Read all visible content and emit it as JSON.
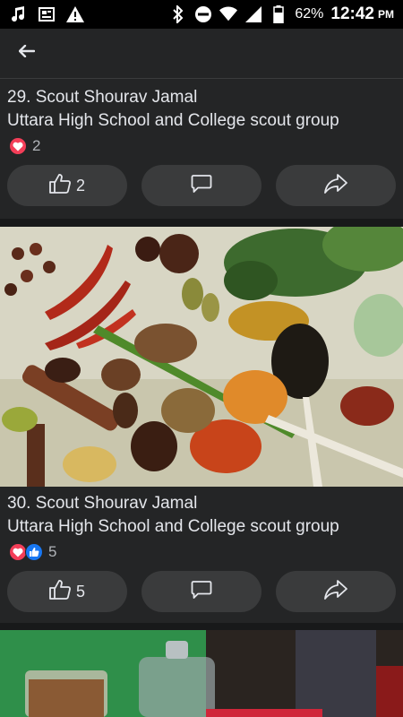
{
  "status_bar": {
    "battery": "62%",
    "time": "12:42",
    "ampm": "PM",
    "icons": [
      "music-icon",
      "news-icon",
      "warning-icon",
      "bluetooth-icon",
      "dnd-icon",
      "wifi-icon",
      "signal-icon",
      "battery-icon"
    ]
  },
  "header": {
    "back_icon": "arrow-left-icon"
  },
  "posts": [
    {
      "title": "29. Scout Shourav Jamal",
      "subtitle": "Uttara High School and College scout group",
      "reaction_count": "2",
      "like_count": "2"
    },
    {
      "title": "30. Scout Shourav Jamal",
      "subtitle": "Uttara High School and College scout group",
      "reaction_count": "5",
      "like_count": "5"
    }
  ],
  "colors": {
    "background": "#18191a",
    "card": "#242526",
    "button": "#3a3b3c",
    "love": "#f33e58",
    "like": "#1877f2"
  }
}
